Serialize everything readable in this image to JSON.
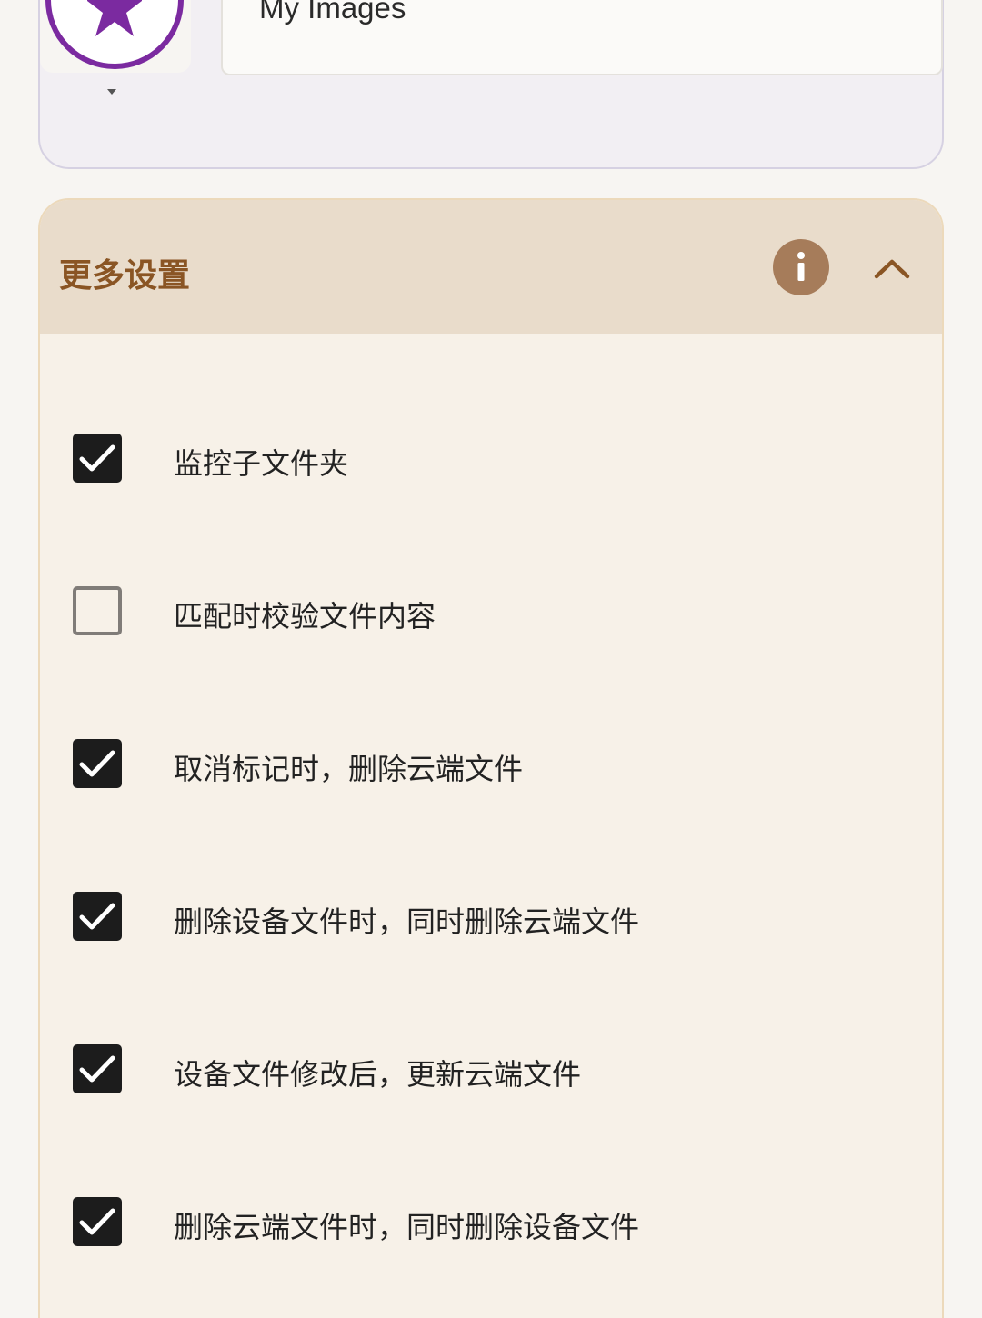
{
  "folder": {
    "name": "My Images",
    "icon": "star-icon",
    "icon_color": "#7b2aa0"
  },
  "more_settings": {
    "title": "更多设置",
    "info_icon": "info-icon",
    "collapse_icon": "chevron-up-icon",
    "accent_color": "#8a5524",
    "options": [
      {
        "label": "监控子文件夹",
        "checked": true
      },
      {
        "label": "匹配时校验文件内容",
        "checked": false
      },
      {
        "label": "取消标记时，删除云端文件",
        "checked": true
      },
      {
        "label": "删除设备文件时，同时删除云端文件",
        "checked": true
      },
      {
        "label": "设备文件修改后，更新云端文件",
        "checked": true
      },
      {
        "label": "删除云端文件时，同时删除设备文件",
        "checked": true
      }
    ]
  }
}
